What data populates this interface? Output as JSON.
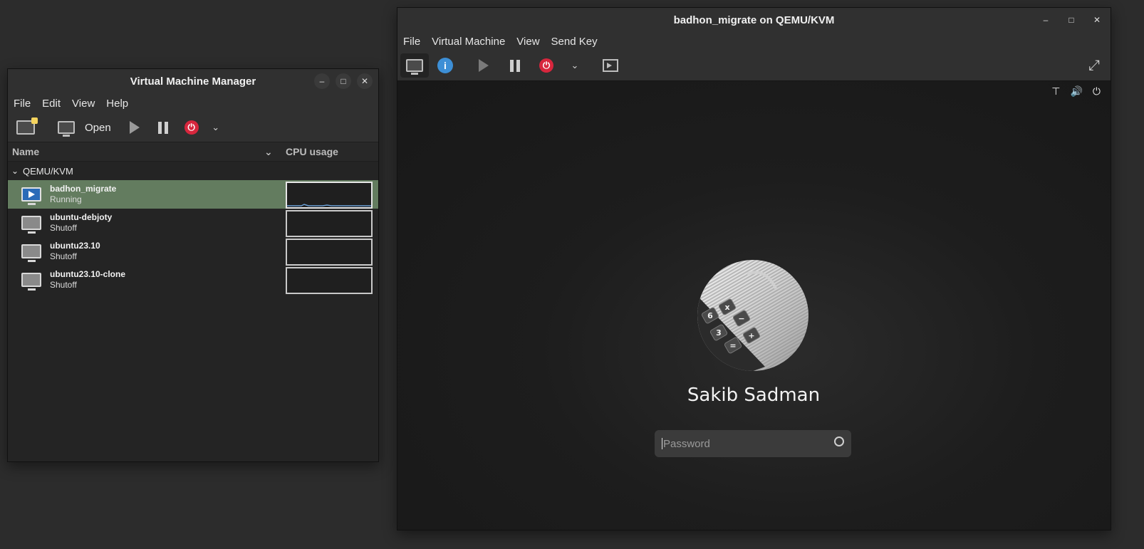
{
  "vmm": {
    "title": "Virtual Machine Manager",
    "menu": [
      "File",
      "Edit",
      "View",
      "Help"
    ],
    "toolbar": {
      "open_label": "Open"
    },
    "columns": {
      "name": "Name",
      "cpu": "CPU usage"
    },
    "group": "QEMU/KVM",
    "vms": [
      {
        "name": "badhon_migrate",
        "state": "Running"
      },
      {
        "name": "ubuntu-debjoty",
        "state": "Shutoff"
      },
      {
        "name": "ubuntu23.10",
        "state": "Shutoff"
      },
      {
        "name": "ubuntu23.10-clone",
        "state": "Shutoff"
      }
    ]
  },
  "console": {
    "title": "badhon_migrate on QEMU/KVM",
    "menu": [
      "File",
      "Virtual Machine",
      "View",
      "Send Key"
    ],
    "login": {
      "user_name": "Sakib Sadman",
      "password_placeholder": "Password"
    },
    "avatar_keys": [
      "6",
      "x",
      "−",
      "3",
      "+",
      "="
    ]
  },
  "colors": {
    "selected_row": "#637c5f",
    "power_red": "#d7263d",
    "info_blue": "#3d8fd6",
    "vm_running_blue": "#2a6bb8"
  }
}
